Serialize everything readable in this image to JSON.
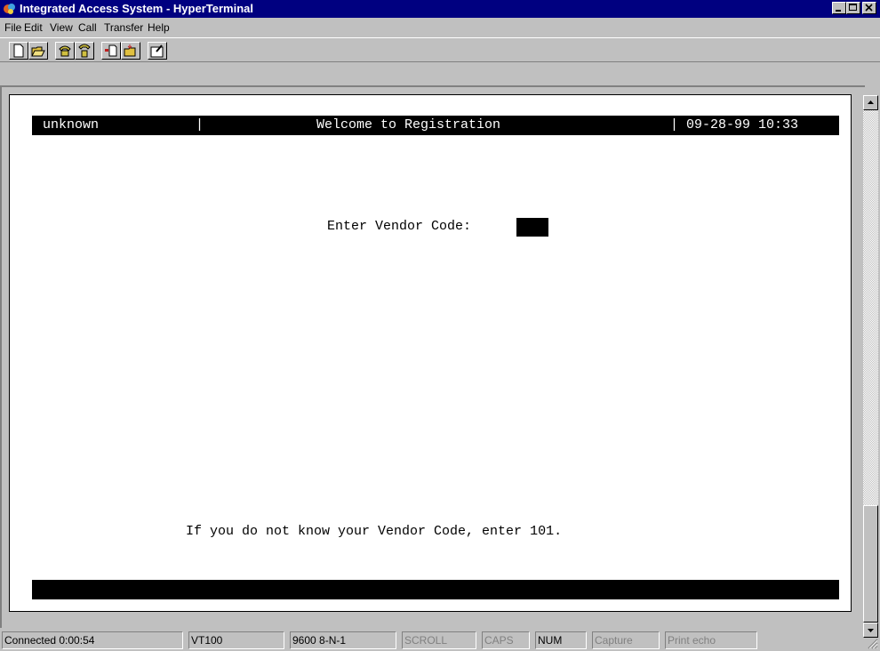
{
  "window": {
    "title": "Integrated Access System - HyperTerminal"
  },
  "menu": {
    "file": "File",
    "edit": "Edit",
    "view": "View",
    "call": "Call",
    "transfer": "Transfer",
    "help": "Help"
  },
  "terminal": {
    "header_left": "unknown",
    "header_sep1": "|",
    "header_center": "Welcome to Registration",
    "header_right": "| 09-28-99 10:33",
    "prompt": "Enter Vendor Code:",
    "hint": "If you do not know your Vendor Code, enter 101."
  },
  "status": {
    "connected": "Connected 0:00:54",
    "emulation": "VT100",
    "settings": "9600 8-N-1",
    "scroll": "SCROLL",
    "caps": "CAPS",
    "num": "NUM",
    "capture": "Capture",
    "print_echo": "Print echo"
  },
  "icons": {
    "app": "hyperterminal-app-icon",
    "new": "new-document-icon",
    "open": "open-folder-icon",
    "connect": "phone-connect-icon",
    "disconnect": "phone-disconnect-icon",
    "send": "send-file-icon",
    "receive": "receive-file-icon",
    "properties": "properties-icon"
  },
  "colors": {
    "titlebar": "#000080",
    "face": "#c0c0c0",
    "terminal_bg": "#ffffff",
    "terminal_fg": "#000000"
  }
}
